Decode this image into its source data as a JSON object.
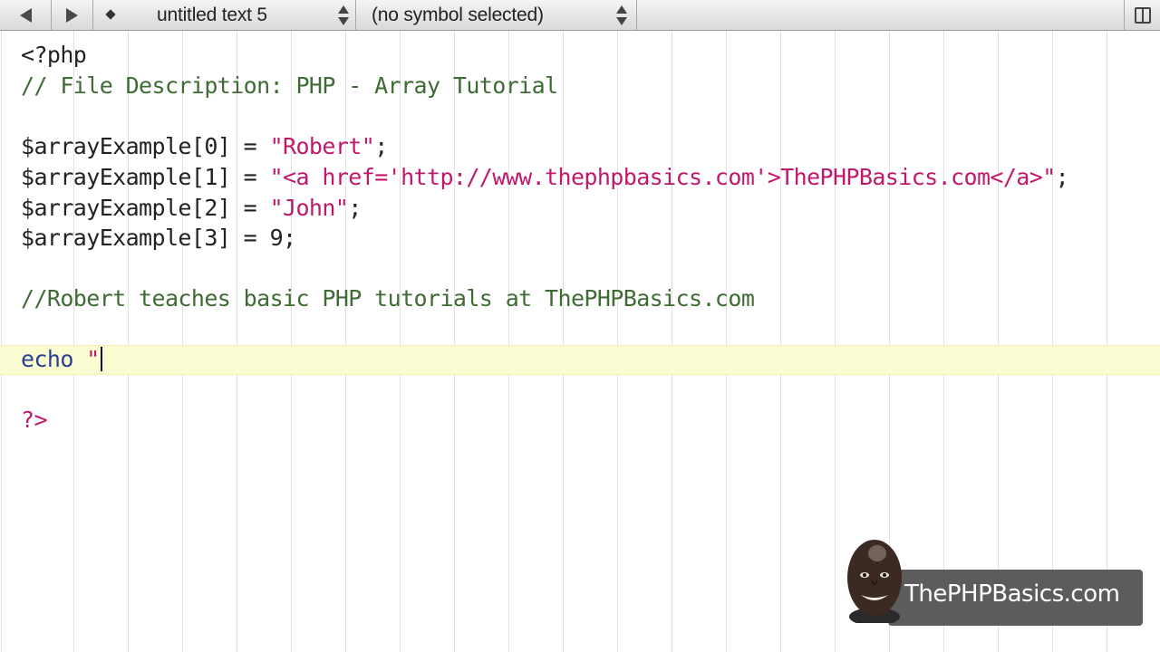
{
  "toolbar": {
    "document_name": "untitled text 5",
    "symbol_selector": "(no symbol selected)"
  },
  "editor": {
    "lines": {
      "l1": "<?php",
      "l2": "// File Description: PHP - Array Tutorial",
      "l4a": "$arrayExample[0] = ",
      "l4b": "\"Robert\"",
      "l4c": ";",
      "l5a": "$arrayExample[1] = ",
      "l5b": "\"<a href='http://www.thephpbasics.com'>ThePHPBasics.com</a>\"",
      "l5c": ";",
      "l6a": "$arrayExample[2] = ",
      "l6b": "\"John\"",
      "l6c": ";",
      "l7": "$arrayExample[3] = 9;",
      "l9": "//Robert teaches basic PHP tutorials at ThePHPBasics.com",
      "l11a": "echo ",
      "l11b": "\"",
      "l13": "?>"
    }
  },
  "watermark": {
    "brand": "ThePHPBasics.com"
  },
  "icons": [
    "back-arrow-icon",
    "forward-arrow-icon",
    "document-diamond-icon",
    "popup-updown-icon",
    "book-icon",
    "presenter-avatar-icon"
  ],
  "colors": {
    "comment": "#3f6b34",
    "string": "#c0196c",
    "keyword": "#2a4090",
    "current_line": "#fcfcd2"
  }
}
